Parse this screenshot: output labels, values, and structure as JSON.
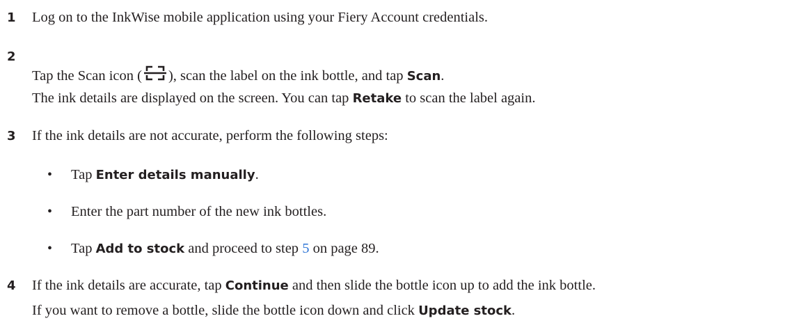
{
  "steps": [
    {
      "number": "1",
      "lines": [
        {
          "parts": [
            {
              "text": "Log on to the InkWise mobile application using your Fiery Account credentials.",
              "style": "normal"
            }
          ]
        }
      ]
    },
    {
      "number": "2",
      "lines": [
        {
          "parts": [
            {
              "text": "Tap the Scan icon (",
              "style": "normal"
            },
            {
              "icon": "scan-icon"
            },
            {
              "text": "), scan the label on the ink bottle, and tap ",
              "style": "normal"
            },
            {
              "text": "Scan",
              "style": "bold"
            },
            {
              "text": ".",
              "style": "normal"
            }
          ]
        },
        {
          "parts": [
            {
              "text": "The ink details are displayed on the screen. You can tap ",
              "style": "normal"
            },
            {
              "text": "Retake",
              "style": "bold"
            },
            {
              "text": " to scan the label again.",
              "style": "normal"
            }
          ]
        }
      ]
    },
    {
      "number": "3",
      "lines": [
        {
          "parts": [
            {
              "text": "If the ink details are not accurate, perform the following steps:",
              "style": "normal"
            }
          ]
        }
      ],
      "bullets": [
        {
          "parts": [
            {
              "text": "Tap ",
              "style": "normal"
            },
            {
              "text": "Enter details manually",
              "style": "bold"
            },
            {
              "text": ".",
              "style": "normal"
            }
          ]
        },
        {
          "parts": [
            {
              "text": "Enter the part number of the new ink bottles.",
              "style": "normal"
            }
          ]
        },
        {
          "parts": [
            {
              "text": "Tap ",
              "style": "normal"
            },
            {
              "text": "Add to stock",
              "style": "bold"
            },
            {
              "text": " and proceed to step ",
              "style": "normal"
            },
            {
              "text": "5",
              "style": "link"
            },
            {
              "text": " on page 89.",
              "style": "normal"
            }
          ]
        }
      ]
    },
    {
      "number": "4",
      "lines": [
        {
          "parts": [
            {
              "text": "If the ink details are accurate, tap ",
              "style": "normal"
            },
            {
              "text": "Continue",
              "style": "bold"
            },
            {
              "text": " and then slide the bottle icon up to add the ink bottle.",
              "style": "normal"
            }
          ]
        },
        {
          "parts": [
            {
              "text": "If you want to remove a bottle, slide the bottle icon down and click ",
              "style": "normal"
            },
            {
              "text": "Update stock",
              "style": "bold"
            },
            {
              "text": ".",
              "style": "normal"
            }
          ]
        }
      ]
    }
  ],
  "bullet_char": "•",
  "colors": {
    "text": "#231f20",
    "link": "#2e75d6"
  }
}
